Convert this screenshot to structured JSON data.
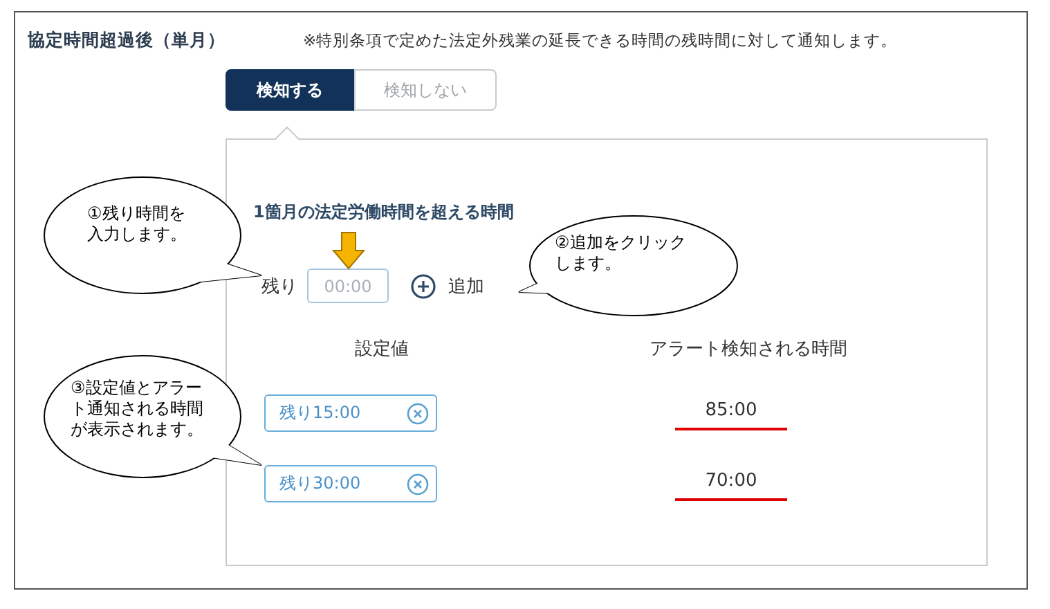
{
  "section": {
    "title": "協定時間超過後（単月）",
    "note": "※特別条項で定めた法定外残業の延長できる時間の残時間に対して通知します。"
  },
  "toggle": [
    {
      "label": "検知する",
      "selected": true
    },
    {
      "label": "検知しない",
      "selected": false
    }
  ],
  "panel": {
    "heading": "1箇月の法定労働時間を超える時間",
    "remaining_label": "残り",
    "remaining_placeholder": "00:00",
    "add_label": "追加",
    "columns": [
      "設定値",
      "アラート検知される時間"
    ],
    "rows": [
      {
        "setting": "残り15:00",
        "alert_time": "85:00",
        "underlined": true
      },
      {
        "setting": "残り30:00",
        "alert_time": "70:00",
        "underlined": true
      }
    ]
  },
  "callouts": [
    "①残り時間を入力します。",
    "②追加をクリックします。",
    "③設定値とアラート通知される時間が表示されます。"
  ]
}
